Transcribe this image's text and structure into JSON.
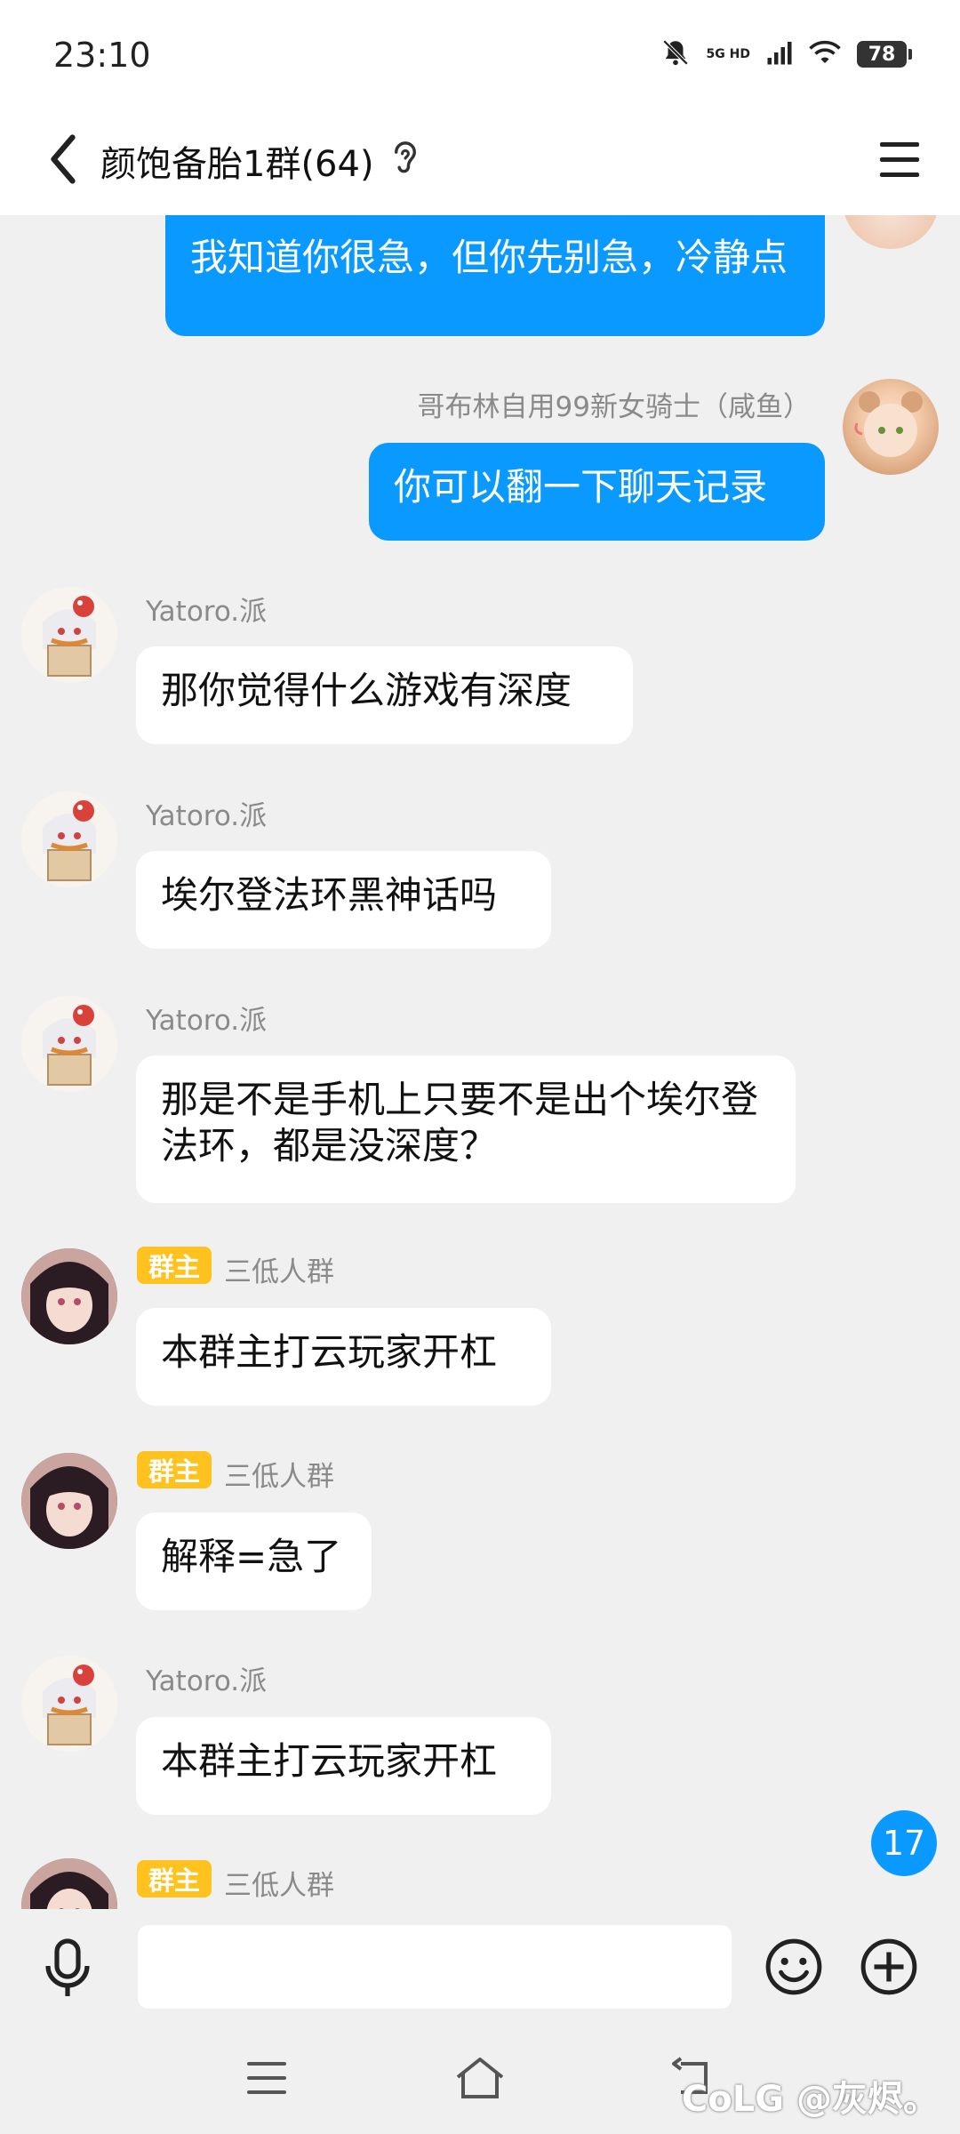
{
  "status_bar": {
    "time": "23:10",
    "network_top": "5G HD",
    "battery": "78",
    "icons": [
      "mute-bell-icon",
      "signal-icon",
      "wifi-icon",
      "battery-icon"
    ]
  },
  "header": {
    "title": "颜饱备胎1群(64)",
    "icons": [
      "back-icon",
      "ear-icon",
      "menu-icon"
    ]
  },
  "messages": [
    {
      "side": "self",
      "text": "我知道你很急，但你先别急，冷静点"
    },
    {
      "side": "self",
      "sender": "哥布林自用99新女骑士（咸鱼）",
      "text": "你可以翻一下聊天记录"
    },
    {
      "side": "other",
      "sender": "Yatoro.派",
      "text": "那你觉得什么游戏有深度"
    },
    {
      "side": "other",
      "sender": "Yatoro.派",
      "text": "埃尔登法环黑神话吗"
    },
    {
      "side": "other",
      "sender": "Yatoro.派",
      "text": "那是不是手机上只要不是出个埃尔登法环，都是没深度？"
    },
    {
      "side": "other",
      "badge": "群主",
      "sender": "三低人群",
      "text": "本群主打云玩家开杠"
    },
    {
      "side": "other",
      "badge": "群主",
      "sender": "三低人群",
      "text": "解释=急了"
    },
    {
      "side": "other",
      "sender": "Yatoro.派",
      "text": "本群主打云玩家开杠"
    },
    {
      "side": "other",
      "badge": "群主",
      "sender": "三低人群",
      "text": ""
    }
  ],
  "unread_count": "17",
  "input_bar": {
    "placeholder": "",
    "icons": [
      "microphone-icon",
      "emoji-icon",
      "plus-icon"
    ]
  },
  "nav_bar": {
    "icons": [
      "recent-apps-icon",
      "home-icon",
      "back-nav-icon"
    ]
  },
  "watermark": "CoLG @灰烬。",
  "colors": {
    "self_bubble": "#0a99ff",
    "other_bubble": "#ffffff",
    "background": "#f0f0f0",
    "owner_badge": "#ffc21f"
  }
}
